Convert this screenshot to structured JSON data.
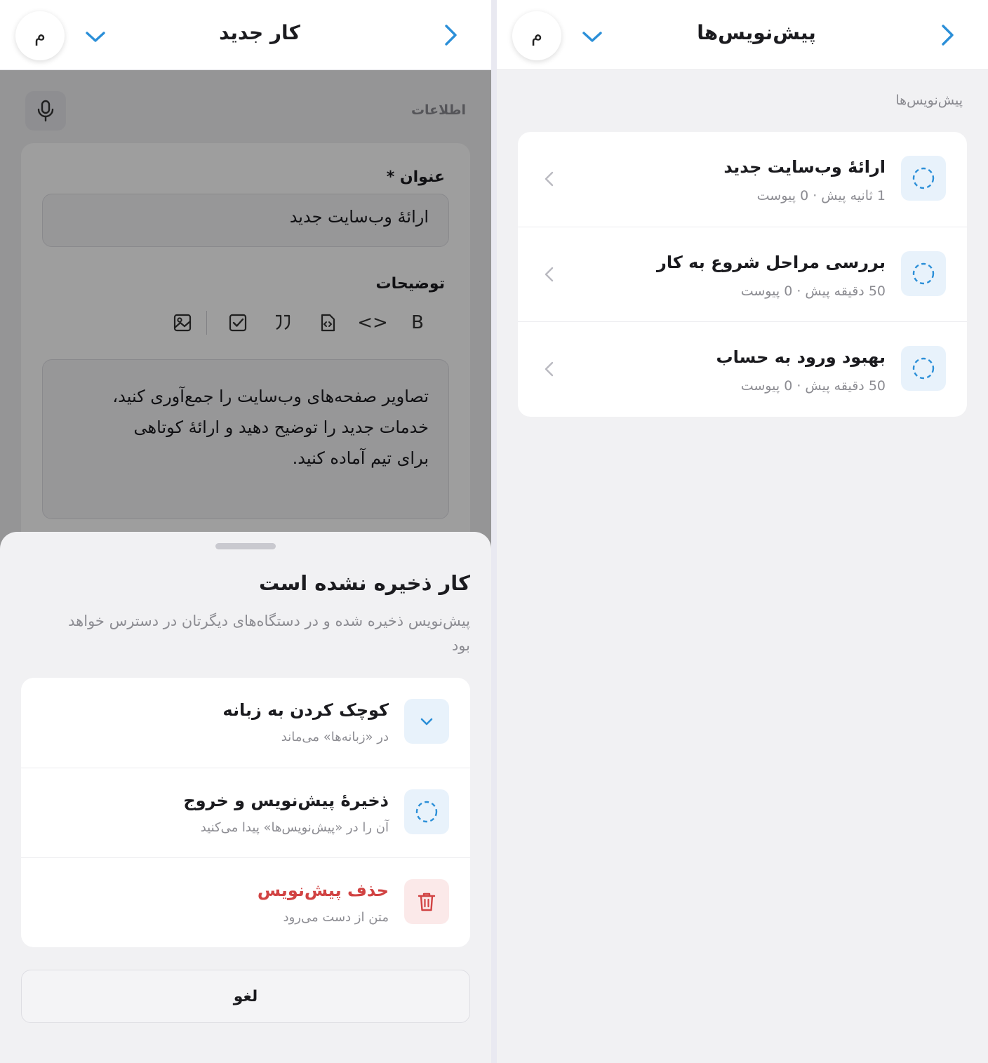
{
  "left": {
    "header": {
      "avatar": "م",
      "title": "کار جدید"
    },
    "form": {
      "section_label": "اطلاعات",
      "title_label": "عنوان *",
      "title_value": "ارائهٔ وب‌سایت جدید",
      "desc_label": "توضیحات",
      "toolbar": {
        "bold": "B",
        "code": "<>"
      },
      "desc_lines": [
        "تصاویر صفحه‌های وب‌سایت را جمع‌آوری کنید،",
        "خدمات جدید را توضیح دهید و ارائهٔ کوتاهی",
        "برای تیم آماده کنید."
      ]
    },
    "sheet": {
      "title": "کار ذخیره نشده است",
      "description": "پیش‌نویس ذخیره شده و در دستگاه‌های دیگرتان در دسترس خواهد بود",
      "options": [
        {
          "title": "کوچک کردن به زبانه",
          "subtitle": "در «زبانه‌ها» می‌ماند",
          "icon": "chevron-down-icon",
          "color": "#1b1b1f"
        },
        {
          "title": "ذخیرهٔ پیش‌نویس و خروج",
          "subtitle": "آن را در «پیش‌نویس‌ها» پیدا می‌کنید",
          "icon": "dashed-circle-icon",
          "color": "#1b1b1f"
        },
        {
          "title": "حذف پیش‌نویس",
          "subtitle": "متن از دست می‌رود",
          "icon": "trash-icon",
          "color": "#d14343"
        }
      ],
      "cancel_label": "لغو"
    }
  },
  "right": {
    "header": {
      "avatar": "م",
      "title": "پیش‌نویس‌ها"
    },
    "section_label": "پیش‌نویس‌ها",
    "drafts": [
      {
        "title": "ارائهٔ وب‌سایت جدید",
        "meta": "1 ثانیه پیش · 0 پیوست"
      },
      {
        "title": "بررسی مراحل شروع به کار",
        "meta": "50 دقیقه پیش · 0 پیوست"
      },
      {
        "title": "بهبود ورود به حساب",
        "meta": "50 دقیقه پیش · 0 پیوست"
      }
    ]
  },
  "colors": {
    "accent": "#2b8fd8",
    "danger": "#d14343",
    "icon_bg": "#e8f2fb",
    "danger_bg": "#fbe9e9"
  }
}
